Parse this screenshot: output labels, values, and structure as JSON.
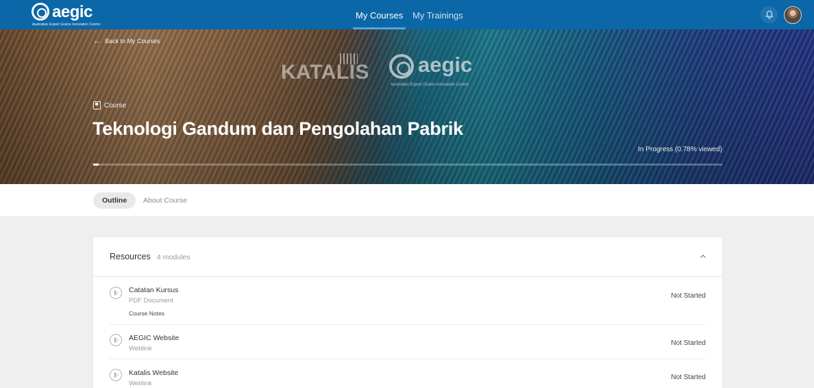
{
  "topbar": {
    "logo_text": "aegic",
    "logo_subtitle": "Australian Export Grains Innovation Centre",
    "tabs": [
      {
        "label": "My Courses",
        "active": true
      },
      {
        "label": "My Trainings",
        "active": false
      }
    ],
    "bell_icon": "bell-icon",
    "accent_color": "#0b67a7"
  },
  "hero": {
    "back_label": "Back to My Courses",
    "partner_logo_text": "KATALIS",
    "aegic_logo_text": "aegic",
    "aegic_logo_subtitle": "Australian Export Grains Innovation Centre",
    "type_label": "Course",
    "title": "Teknologi Gandum dan Pengolahan Pabrik",
    "progress_text": "In Progress (0.78% viewed)",
    "progress_percent": 0.78
  },
  "tabs": [
    {
      "label": "Outline",
      "active": true
    },
    {
      "label": "About Course",
      "active": false
    }
  ],
  "resources": {
    "title": "Resources",
    "count": "4 modules",
    "items": [
      {
        "name": "Catatan Kursus",
        "kind": "PDF Document",
        "note": "Course Notes",
        "status": "Not Started"
      },
      {
        "name": "AEGIC Website",
        "kind": "Weblink",
        "note": "",
        "status": "Not Started"
      },
      {
        "name": "Katalis Website",
        "kind": "Weblink",
        "note": "",
        "status": "Not Started"
      }
    ]
  }
}
